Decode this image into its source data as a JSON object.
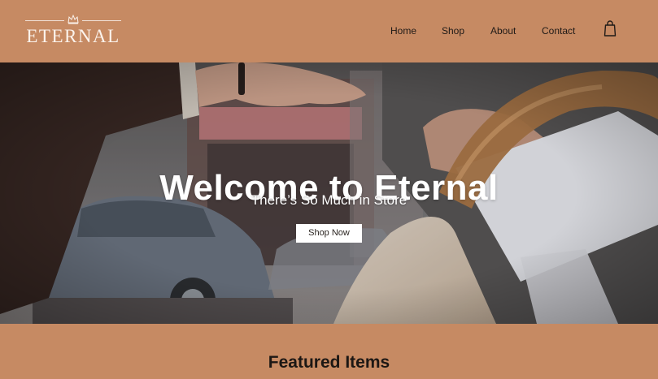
{
  "brand": {
    "logo_text": "Eternal",
    "logo_icon": "crown-icon",
    "color_header": "#c68a63",
    "color_logo": "#fbf3ec"
  },
  "nav": {
    "items": [
      {
        "label": "Home"
      },
      {
        "label": "Shop"
      },
      {
        "label": "About"
      },
      {
        "label": "Contact"
      }
    ],
    "cart_icon": "shopping-bag-icon"
  },
  "hero": {
    "title": "Welcome to Eternal",
    "subtitle": "There’s So Much in Store",
    "cta_label": "Shop Now",
    "background": "photo of a shopper handing over a shopping bag on a city street"
  },
  "featured": {
    "title": "Featured Items"
  }
}
